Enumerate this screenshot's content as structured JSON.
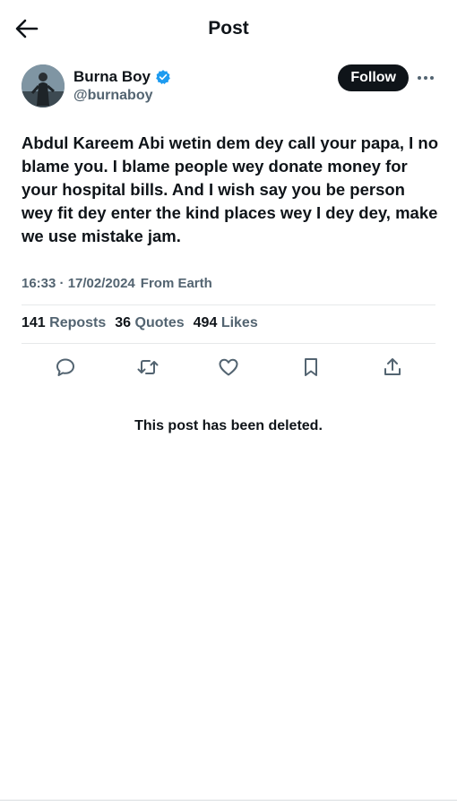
{
  "header": {
    "title": "Post",
    "back_icon": "arrow-left-icon"
  },
  "author": {
    "display_name": "Burna Boy",
    "handle": "@burnaboy",
    "verified_icon": "verified-badge-icon",
    "verified_color": "#1d9bf0",
    "follow_label": "Follow",
    "more_icon": "more-horizontal-icon"
  },
  "post": {
    "text": "Abdul Kareem Abi wetin dem dey call your papa, I no blame you. I blame people wey donate money for your hospital bills. And I wish say you be person wey fit dey enter the kind places wey I dey dey, make we use mistake jam.",
    "time": "16:33 · 17/02/2024",
    "location": "From Earth"
  },
  "stats": {
    "reposts_count": "141",
    "reposts_label": "Reposts",
    "quotes_count": "36",
    "quotes_label": "Quotes",
    "likes_count": "494",
    "likes_label": "Likes"
  },
  "actions": [
    "reply-icon",
    "repost-icon",
    "like-icon",
    "bookmark-icon",
    "share-icon"
  ],
  "deleted_notice": "This post has been deleted.",
  "colors": {
    "text": "#0f1419",
    "secondary": "#536471",
    "divider": "#e6e9ea"
  }
}
